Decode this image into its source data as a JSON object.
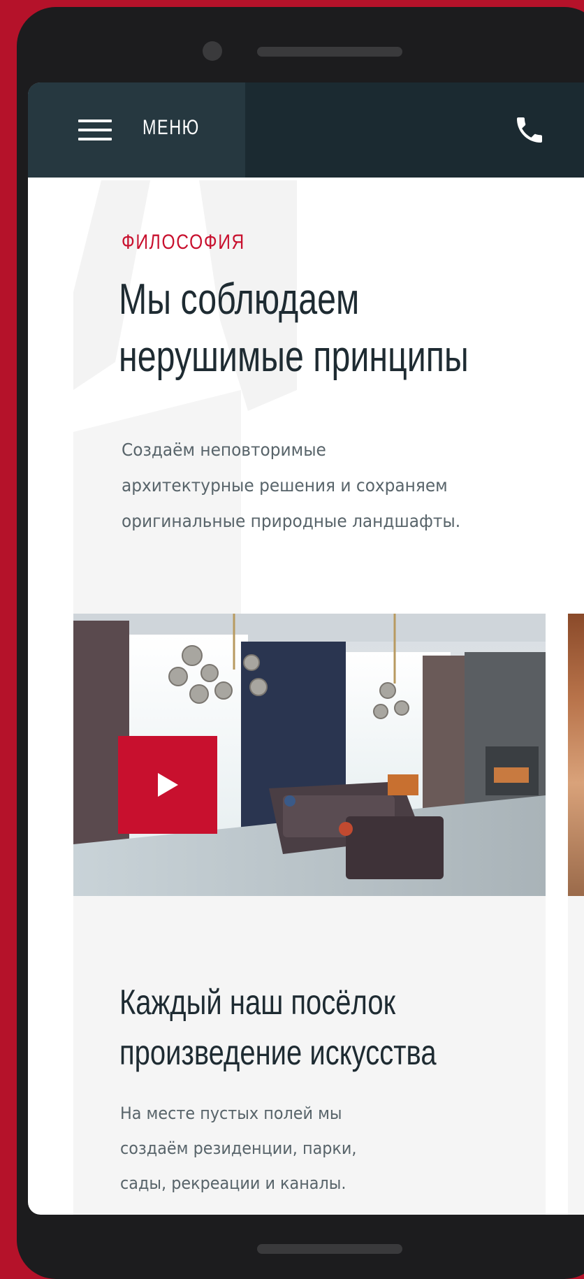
{
  "navbar": {
    "menu_label": "МЕНЮ"
  },
  "philosophy": {
    "eyebrow": "ФИЛОСОФИЯ",
    "title_line1": "Мы соблюдаем",
    "title_line2": "нерушимые принципы",
    "lead_line1": "Создаём неповторимые",
    "lead_line2": "архитектурные решения и сохраняем",
    "lead_line3": "оригинальные природные ландшафты."
  },
  "card": {
    "title_line1": "Каждый наш посёлок",
    "title_line2": "произведение искусства",
    "text_line1": "На месте пустых полей мы",
    "text_line2": "создаём резиденции, парки,",
    "text_line3": "сады, рекреации и каналы."
  },
  "colors": {
    "accent": "#c8102e",
    "navbar": "#1b2a31",
    "menu_button": "#263840",
    "frame": "#b5122a",
    "heading": "#1e2b32",
    "body_text": "#58646a"
  },
  "icons": {
    "menu": "hamburger-icon",
    "phone": "phone-icon",
    "play": "play-icon"
  }
}
